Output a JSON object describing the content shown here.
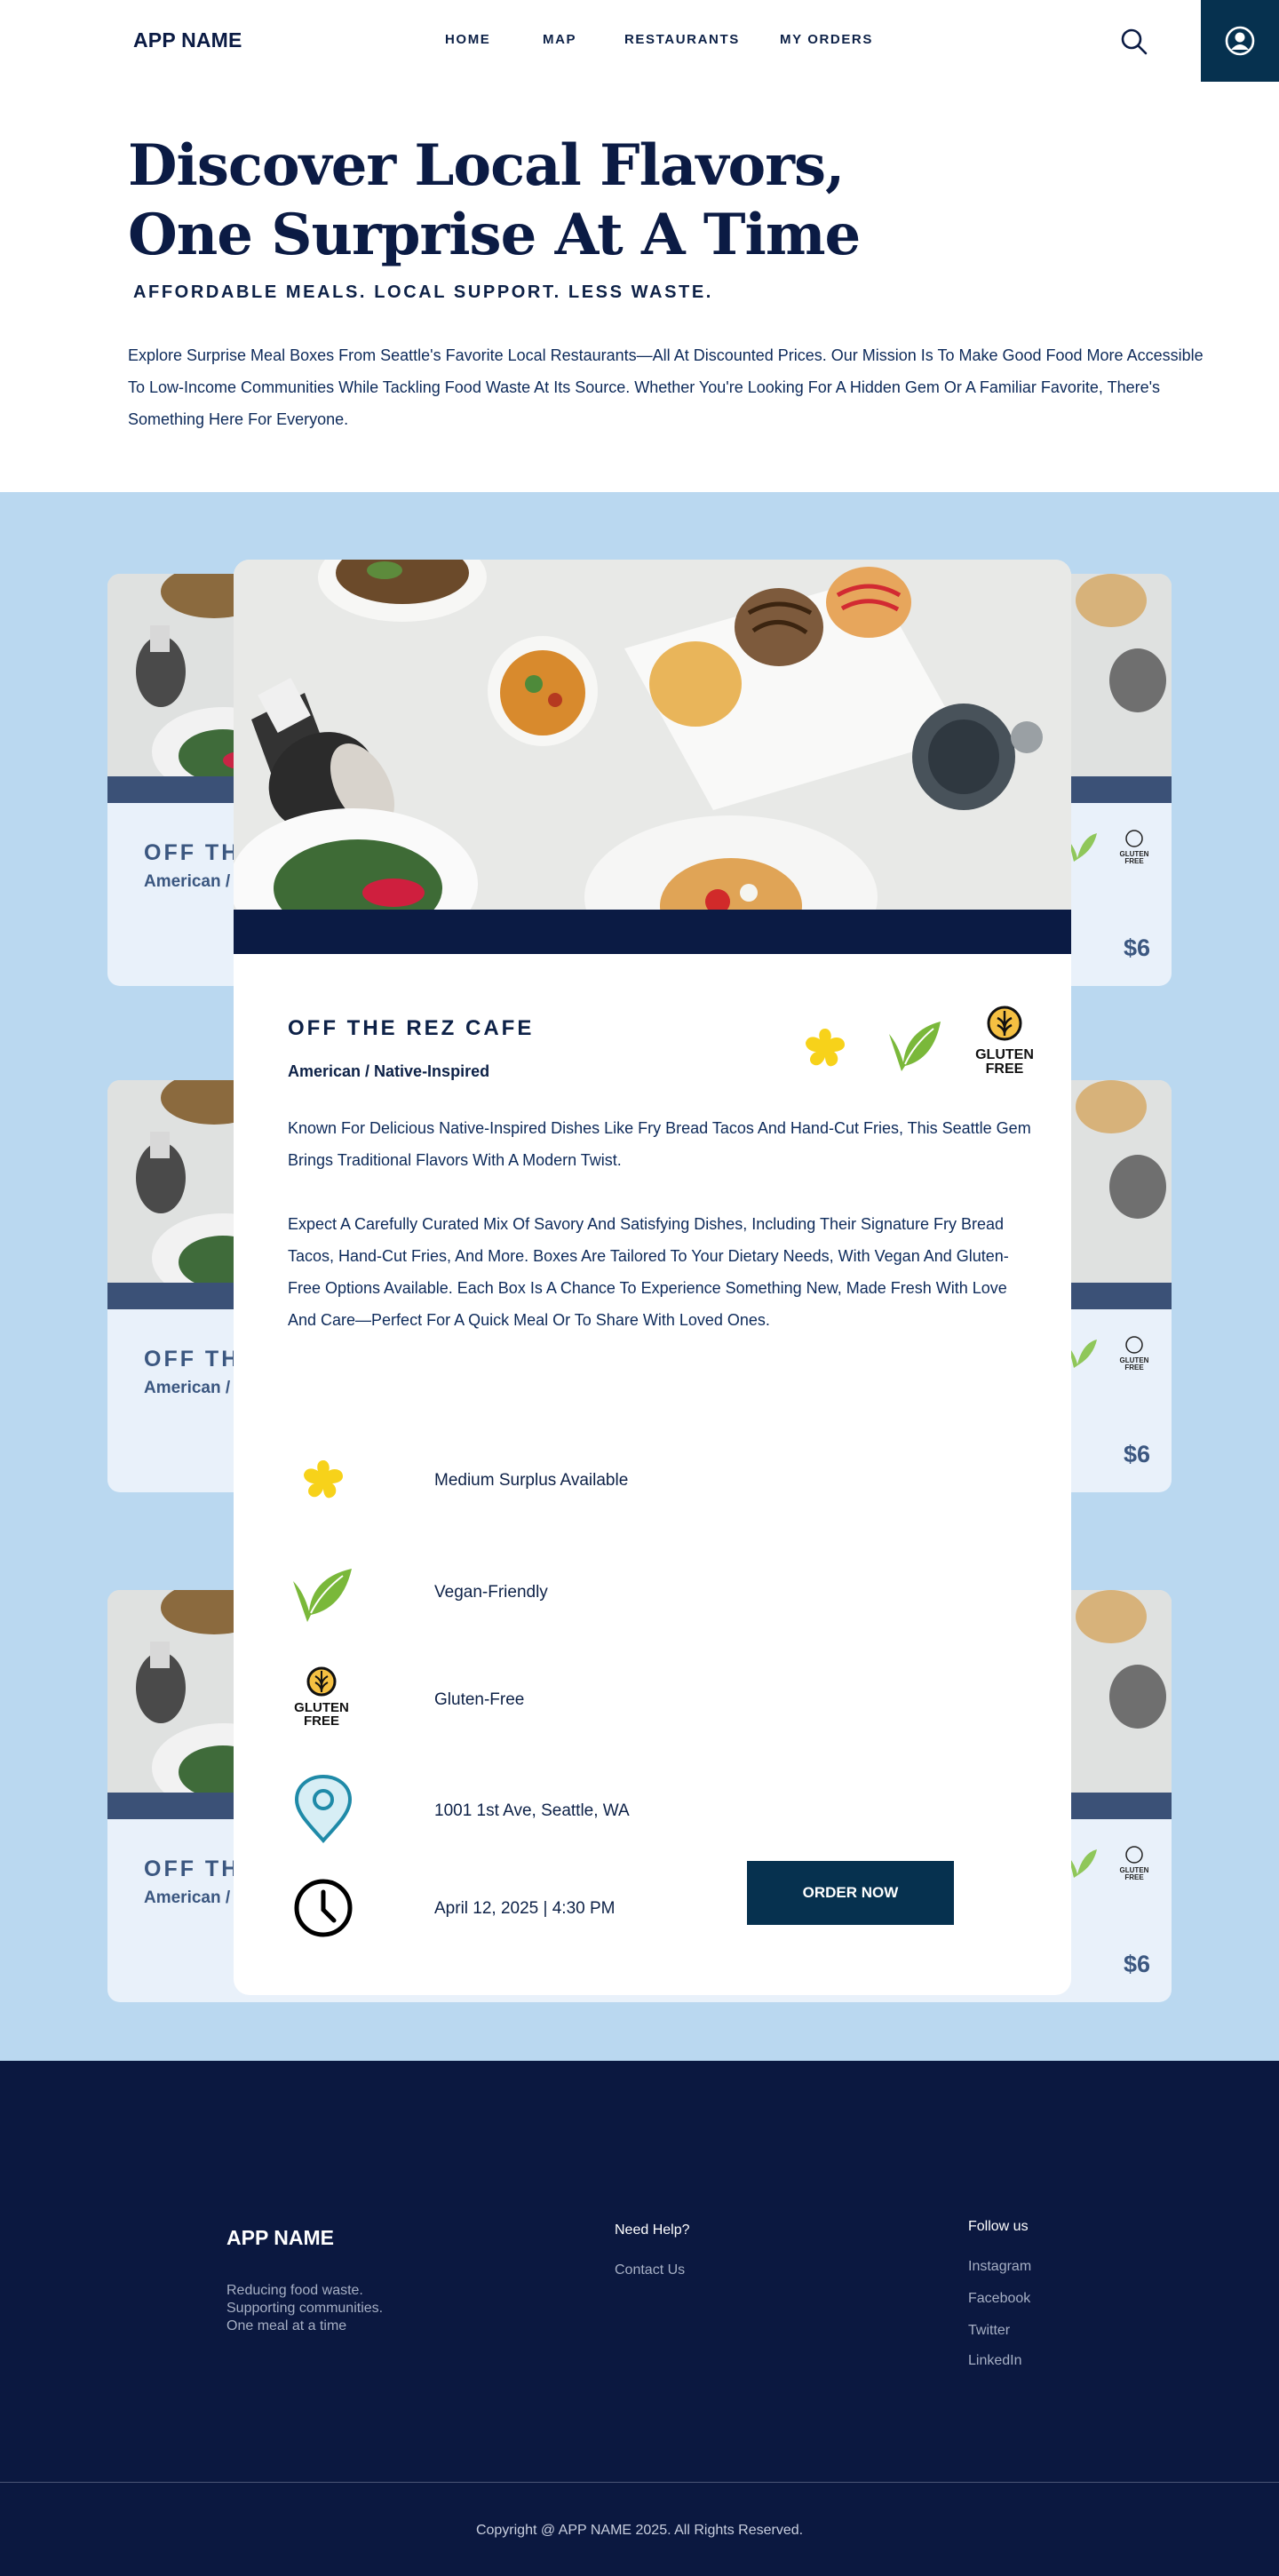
{
  "header": {
    "logo": "APP NAME",
    "nav": [
      "HOME",
      "MAP",
      "RESTAURANTS",
      "MY ORDERS"
    ]
  },
  "hero": {
    "title_line1": "Discover Local Flavors,",
    "title_line2": "One Surprise At A Time",
    "subtitle": "AFFORDABLE MEALS. LOCAL SUPPORT. LESS WASTE.",
    "description": "Explore Surprise Meal Boxes From Seattle's Favorite Local Restaurants—All At Discounted Prices. Our Mission Is To Make Good Food More Accessible To Low-Income Communities While Tackling Food Waste At Its Source. Whether You're Looking For A Hidden Gem Or A Familiar Favorite, There's Something Here For Everyone."
  },
  "background_cards": [
    {
      "name": "OFF TH",
      "cuisine": "American /",
      "price": "$6"
    },
    {
      "name": "OFF TH",
      "cuisine": "American /",
      "price": "$6"
    },
    {
      "name": "OFF TH",
      "cuisine": "American /",
      "price": "$6"
    }
  ],
  "featured": {
    "name": "OFF THE REZ CAFE",
    "cuisine": "American / Native-Inspired",
    "description_1": "Known For Delicious Native-Inspired Dishes Like Fry Bread Tacos And Hand-Cut Fries, This Seattle Gem Brings Traditional Flavors With A Modern Twist.",
    "description_2": "Expect A Carefully Curated Mix Of Savory And Satisfying Dishes, Including Their Signature Fry Bread Tacos, Hand-Cut Fries, And More. Boxes Are Tailored To Your Dietary Needs, With Vegan And Gluten-Free Options Available. Each Box Is A Chance To Experience Something New, Made Fresh With Love And Care—Perfect For A Quick Meal Or To Share With Loved Ones.",
    "badge_gluten_text": [
      "GLUTEN",
      "FREE"
    ],
    "features": [
      {
        "icon": "flower-icon",
        "label": "Medium Surplus Available"
      },
      {
        "icon": "leaf-icon",
        "label": "Vegan-Friendly"
      },
      {
        "icon": "gluten-free-icon",
        "label": "Gluten-Free"
      },
      {
        "icon": "location-pin-icon",
        "label": "1001 1st Ave, Seattle, WA"
      },
      {
        "icon": "clock-icon",
        "label": "April 12, 2025 | 4:30 PM"
      }
    ],
    "order_button": "ORDER NOW"
  },
  "footer": {
    "logo": "APP NAME",
    "tagline": [
      "Reducing food waste.",
      "Supporting communities.",
      "One meal at a time"
    ],
    "help_heading": "Need Help?",
    "help_links": [
      "Contact Us"
    ],
    "follow_heading": "Follow us",
    "social_links": [
      "Instagram",
      "Facebook",
      "Twitter",
      "LinkedIn"
    ],
    "copyright": "Copyright @ APP NAME 2025. All Rights Reserved."
  },
  "colors": {
    "navy": "#0b1b44",
    "button": "#06314f",
    "section_bg": "#bad8f0",
    "flower": "#f7d21a",
    "leaf": "#7ab83a",
    "pin": "#1f8aa8"
  }
}
